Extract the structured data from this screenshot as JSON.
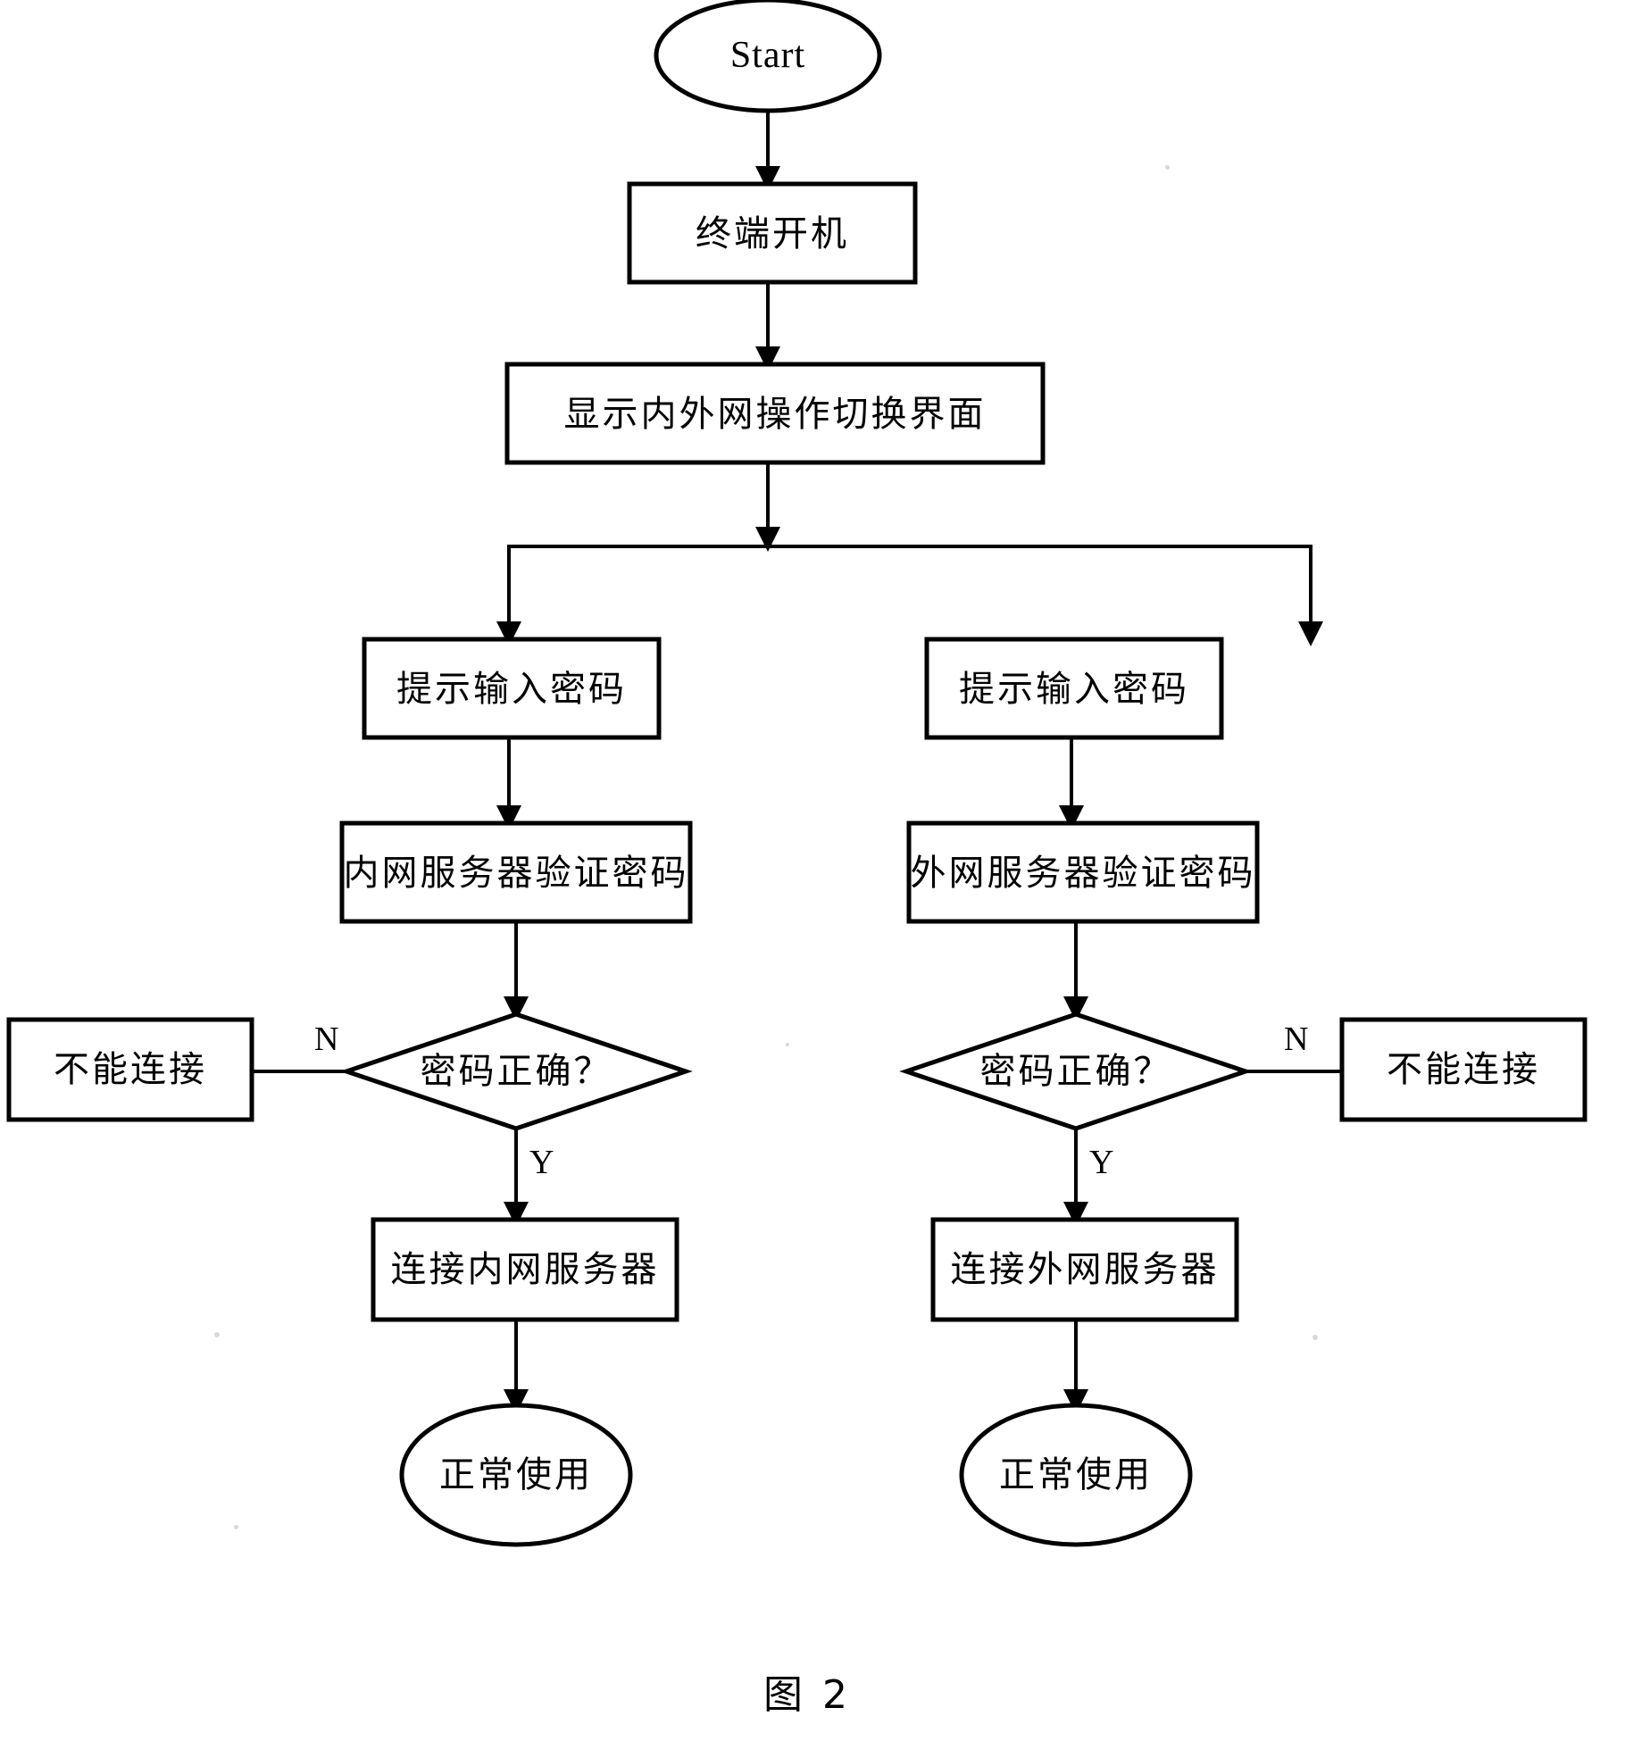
{
  "figure": {
    "caption": "图 2",
    "type": "flowchart",
    "ink_color": "#000000",
    "background_color": "#ffffff"
  },
  "nodes": {
    "start": {
      "label": "Start",
      "shape": "ellipse"
    },
    "power_on": {
      "label": "终端开机",
      "shape": "process"
    },
    "show_switch_ui": {
      "label": "显示内外网操作切换界面",
      "shape": "process"
    },
    "left_prompt_password": {
      "label": "提示输入密码",
      "shape": "process"
    },
    "left_verify": {
      "label": "内网服务器验证密码",
      "shape": "process"
    },
    "left_decision": {
      "label": "密码正确？",
      "shape": "decision"
    },
    "left_cannot_connect": {
      "label": "不能连接",
      "shape": "process"
    },
    "left_connect": {
      "label": "连接内网服务器",
      "shape": "process"
    },
    "left_normal_use": {
      "label": "正常使用",
      "shape": "ellipse"
    },
    "right_prompt_password": {
      "label": "提示输入密码",
      "shape": "process"
    },
    "right_verify": {
      "label": "外网服务器验证密码",
      "shape": "process"
    },
    "right_decision": {
      "label": "密码正确？",
      "shape": "decision"
    },
    "right_cannot_connect": {
      "label": "不能连接",
      "shape": "process"
    },
    "right_connect": {
      "label": "连接外网服务器",
      "shape": "process"
    },
    "right_normal_use": {
      "label": "正常使用",
      "shape": "ellipse"
    }
  },
  "edge_labels": {
    "left_no": "N",
    "left_yes": "Y",
    "right_no": "N",
    "right_yes": "Y"
  }
}
